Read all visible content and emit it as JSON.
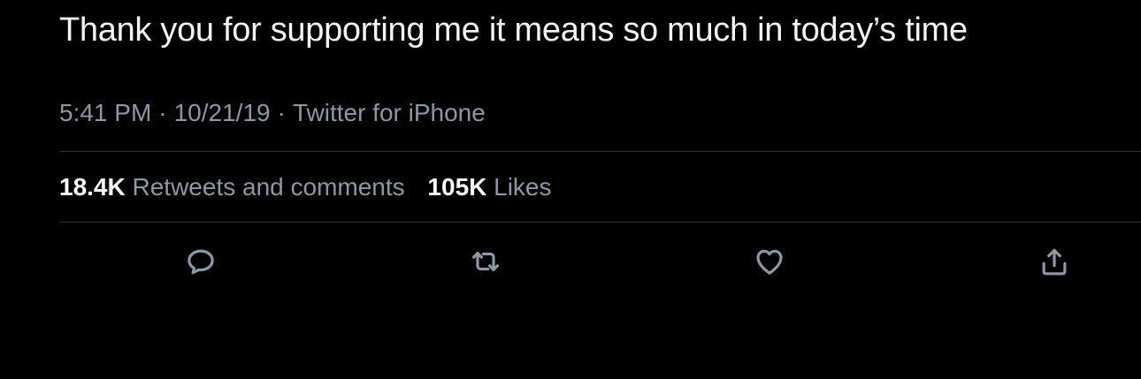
{
  "tweet": {
    "text": "Thank you for supporting me it means so much in today’s time",
    "time": "5:41 PM",
    "date": "10/21/19",
    "source": "Twitter for iPhone",
    "separator": "·"
  },
  "stats": {
    "retweets_count": "18.4K",
    "retweets_label": "Retweets and comments",
    "likes_count": "105K",
    "likes_label": "Likes"
  },
  "actions": {
    "reply_icon": "speech-bubble-icon",
    "retweet_icon": "retweet-arrows-icon",
    "like_icon": "heart-icon",
    "share_icon": "share-upload-icon"
  },
  "colors": {
    "background": "#000000",
    "primary_text": "#ffffff",
    "secondary_text": "#8b98a5",
    "divider": "#2a2d30"
  }
}
